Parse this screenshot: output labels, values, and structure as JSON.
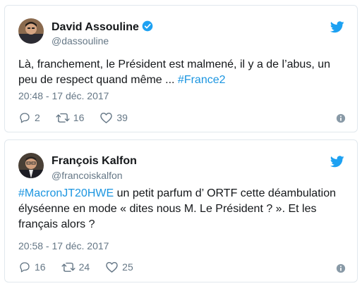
{
  "tweets": [
    {
      "name": "David Assouline",
      "handle": "@dassouline",
      "verified": true,
      "text": "Là, franchement, le Président est malmené, il y a de l’abus, un peu de respect quand même ... ",
      "hashtag": "#France2",
      "time": "20:48 - 17 déc. 2017",
      "replies": "2",
      "retweets": "16",
      "likes": "39"
    },
    {
      "name": "François Kalfon",
      "handle": "@francoiskalfon",
      "verified": false,
      "hashtag": "#MacronJT20HWE",
      "text": " un petit parfum d’ ORTF cette déambulation élyséenne en mode « dites nous M. Le Président ? ». Et les français alors ?",
      "time": "20:58 - 17 déc. 2017",
      "replies": "16",
      "retweets": "24",
      "likes": "25"
    }
  ],
  "icons": {
    "brand": "twitter-bird-icon",
    "verified": "verified-badge-icon",
    "reply": "reply-icon",
    "retweet": "retweet-icon",
    "like": "heart-icon",
    "info": "info-icon"
  },
  "colors": {
    "brand": "#1da1f2",
    "hashtag": "#1b95e0",
    "muted": "#657786",
    "border": "#e1e8ed"
  }
}
